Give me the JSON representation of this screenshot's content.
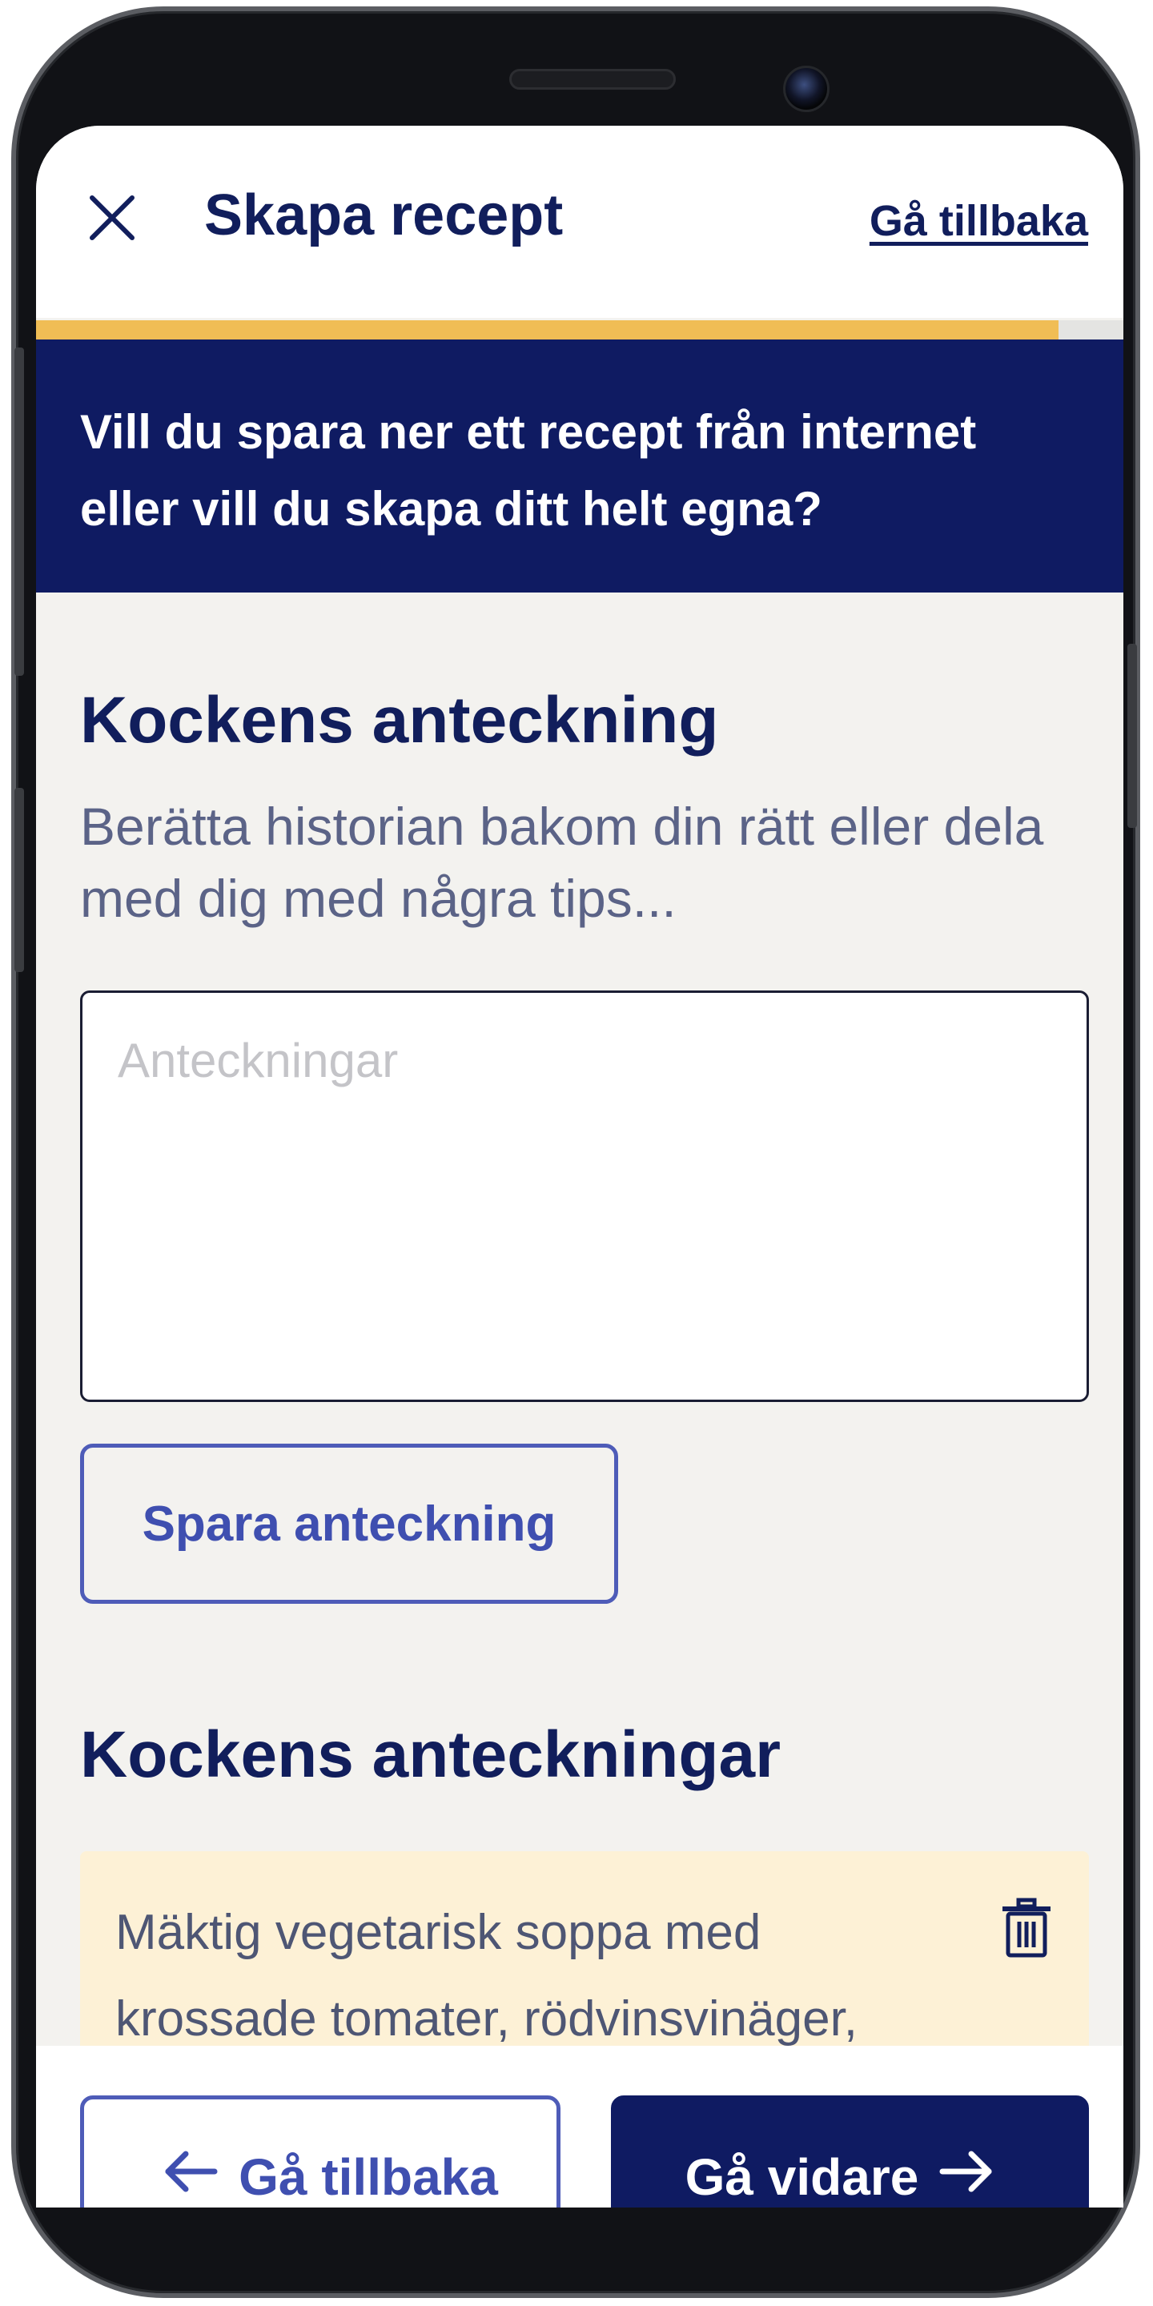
{
  "header": {
    "title": "Skapa recept",
    "back_link": "Gå tillbaka",
    "close_icon": "close-icon"
  },
  "progress": {
    "fraction": 0.94,
    "fill_color": "#f0bd55"
  },
  "banner": {
    "text": "Vill du spara ner ett recept från internet eller vill du skapa ditt helt egna?",
    "background": "#0f1b62"
  },
  "note_section": {
    "heading": "Kockens anteckning",
    "description": "Berätta historian bakom din rätt eller dela med dig med några tips...",
    "input_placeholder": "Anteckningar",
    "input_value": "",
    "save_button": "Spara anteckning"
  },
  "notes_section": {
    "heading": "Kockens anteckningar",
    "items": [
      {
        "text": "Mäktig vegetarisk soppa med krossade tomater, rödvinsvinäger,",
        "icon": "trash-icon"
      }
    ]
  },
  "footer": {
    "back_label": "Gå tillbaka",
    "next_label": "Gå vidare",
    "back_icon": "arrow-left-icon",
    "next_icon": "arrow-right-icon"
  },
  "colors": {
    "brand_navy": "#0f1b62",
    "accent_blue": "#3f4fb0",
    "note_card_bg": "#fdf1d6",
    "page_bg": "#f3f2ef"
  }
}
